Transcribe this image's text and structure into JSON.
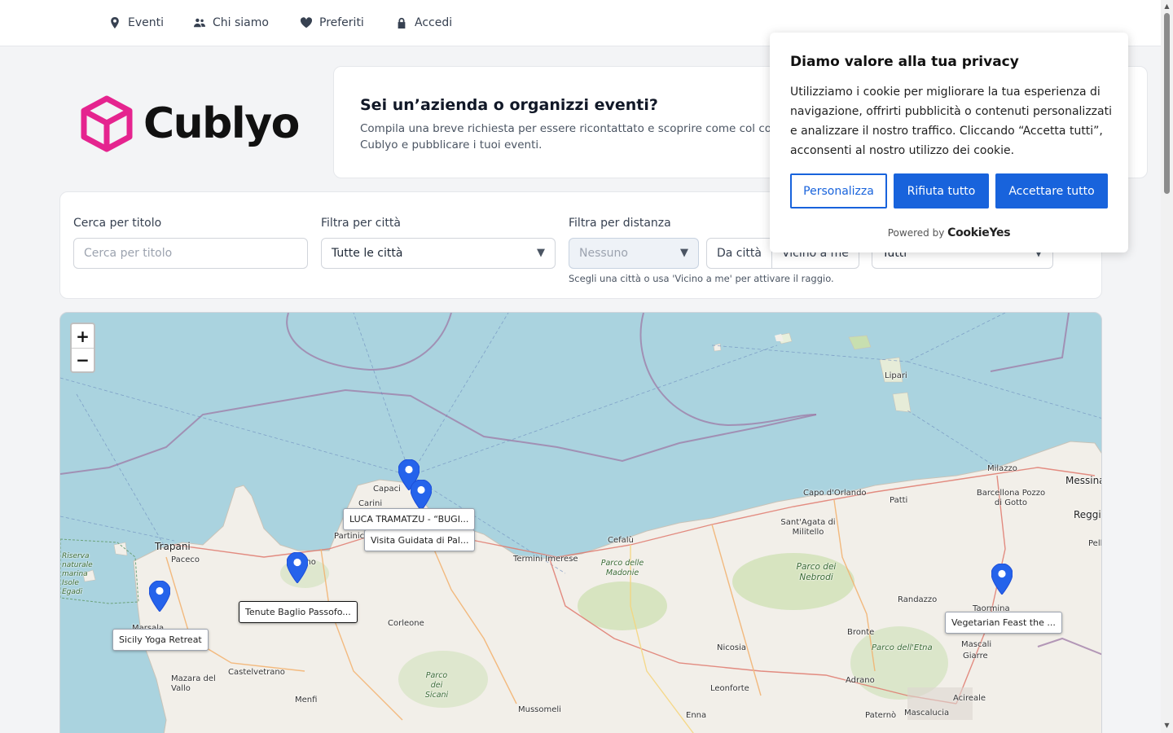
{
  "nav": {
    "items": [
      {
        "label": "Eventi",
        "icon": "map-pin-icon"
      },
      {
        "label": "Chi siamo",
        "icon": "users-icon"
      },
      {
        "label": "Preferiti",
        "icon": "heart-icon"
      },
      {
        "label": "Accedi",
        "icon": "lock-icon"
      }
    ]
  },
  "brand": {
    "name": "Cublyo",
    "accent": "#e5248f"
  },
  "promo": {
    "title": "Sei un’azienda o organizzi eventi?",
    "text": "Compila una breve richiesta per essere ricontattato e scoprire come col con Cublyo e pubblicare i tuoi eventi."
  },
  "filters": {
    "title_label": "Cerca per titolo",
    "title_placeholder": "Cerca per titolo",
    "city_label": "Filtra per città",
    "city_value": "Tutte le città",
    "distance_label": "Filtra per distanza",
    "distance_value": "Nessuno",
    "from_city": "Da città",
    "near_me": "Vicino a me",
    "extra_value": "Tutti",
    "hint": "Scegli una città o usa 'Vicino a me' per attivare il raggio."
  },
  "map": {
    "zoom_in": "+",
    "zoom_out": "−",
    "places": [
      "Lipari",
      "Milazzo",
      "Messina",
      "Barcellona Pozzo di Gotto",
      "Capo d'Orlando",
      "Patti",
      "Reggio C",
      "Sant'Agata di Militello",
      "Cefalù",
      "Termini Imerese",
      "Trapani",
      "Paceco",
      "Capaci",
      "Carini",
      "Partinico",
      "Corleone",
      "Castelvetrano",
      "Mazara del Vallo",
      "Menfi",
      "Mussomeli",
      "Nicosia",
      "Leonforte",
      "Enna",
      "Bronte",
      "Randazzo",
      "Adrano",
      "Paternò",
      "Acireale",
      "Mascalucia",
      "Mascali",
      "Giarre",
      "Taormina",
      "Marsala",
      "Pell",
      "mo"
    ],
    "parks": [
      "Parco dei Nebrodi",
      "Parco delle Madonie",
      "Parco dell'Etna",
      "Parco dei Sicani",
      "Riserva naturale marina Isole Egadi"
    ],
    "events": [
      {
        "label": "LUCA TRAMATZU - “BUGI..."
      },
      {
        "label": "Visita Guidata di Pal..."
      },
      {
        "label": "Tenute Baglio Passofo..."
      },
      {
        "label": "Sicily Yoga Retreat"
      },
      {
        "label": "Vegetarian Feast the ..."
      }
    ]
  },
  "cookie": {
    "title": "Diamo valore alla tua privacy",
    "text": "Utilizziamo i cookie per migliorare la tua esperienza di navigazione, offrirti pubblicità o contenuti personalizzati e analizzare il nostro traffico. Cliccando “Accetta tutti”, acconsenti al nostro utilizzo dei cookie.",
    "customize": "Personalizza",
    "reject": "Rifiuta tutto",
    "accept": "Accettare tutto",
    "powered_prefix": "Powered by",
    "powered_brand": "CookieYes",
    "primary_color": "#1863dc"
  }
}
